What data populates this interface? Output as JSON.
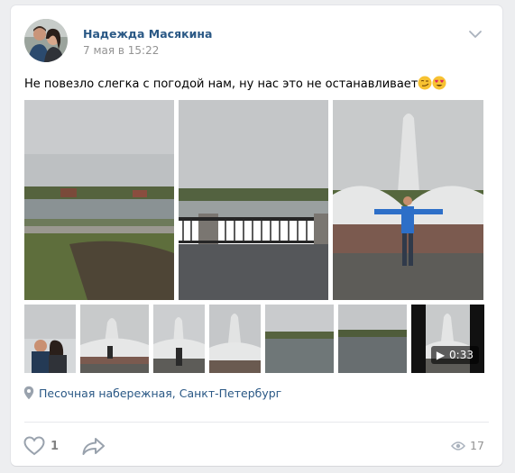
{
  "post": {
    "author_name": "Надежда Масякина",
    "date": "7 мая в 15:22",
    "text": "Не повезло слегка с погодой нам, ну нас это не останавливает",
    "emojis": [
      "smirk-face",
      "heart-eyes-face"
    ]
  },
  "media": {
    "large_photos": [
      {
        "name": "photo-lake-shore",
        "kind": "photo"
      },
      {
        "name": "photo-embankment-railing",
        "kind": "photo"
      },
      {
        "name": "photo-fountain-man",
        "kind": "photo"
      }
    ],
    "thumbnails": [
      {
        "name": "thumb-fountain-couple",
        "kind": "photo"
      },
      {
        "name": "thumb-fountain-woman-1",
        "kind": "photo"
      },
      {
        "name": "thumb-fountain-woman-2",
        "kind": "photo"
      },
      {
        "name": "thumb-fountain",
        "kind": "photo"
      },
      {
        "name": "thumb-lake-1",
        "kind": "photo"
      },
      {
        "name": "thumb-lake-2",
        "kind": "photo"
      },
      {
        "name": "thumb-video-fountain",
        "kind": "video",
        "duration": "0:33"
      }
    ]
  },
  "location": {
    "icon": "location-pin-icon",
    "text": "Песочная набережная, Санкт-Петербург"
  },
  "actions": {
    "like_icon": "heart-icon",
    "like_count": "1",
    "share_icon": "share-arrow-icon",
    "views_icon": "eye-icon",
    "views_count": "17"
  },
  "colors": {
    "link": "#2a5885",
    "muted": "#939393",
    "background": "#edeef0",
    "card": "#ffffff"
  }
}
